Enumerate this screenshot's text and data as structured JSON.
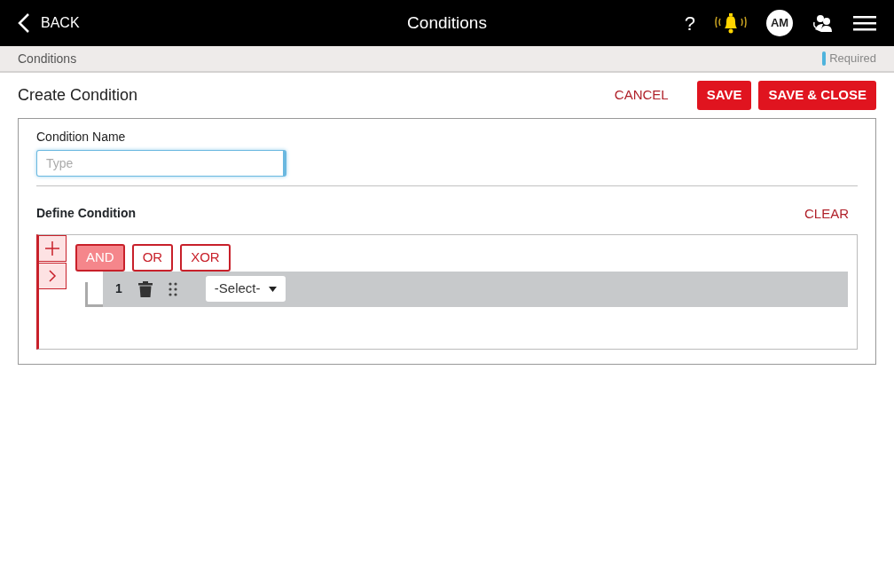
{
  "header": {
    "back_label": "BACK",
    "title": "Conditions",
    "help": "?",
    "avatar": "AM"
  },
  "breadcrumb": {
    "label": "Conditions",
    "legend": "Required"
  },
  "form": {
    "title": "Create Condition",
    "actions": [
      {
        "label": "CANCEL",
        "kind": "text"
      },
      {
        "label": "SAVE",
        "kind": "filled"
      },
      {
        "label": "SAVE & CLOSE",
        "kind": "filled"
      }
    ],
    "name_field": {
      "label": "Condition Name",
      "placeholder": "Type"
    },
    "section_title": "Define Condition",
    "clear_label": "CLEAR",
    "operators": [
      {
        "label": "AND",
        "selected": true
      },
      {
        "label": "OR",
        "selected": false
      },
      {
        "label": "XOR",
        "selected": false
      }
    ],
    "rules": [
      {
        "number": "1",
        "select": "-Select-"
      }
    ]
  }
}
